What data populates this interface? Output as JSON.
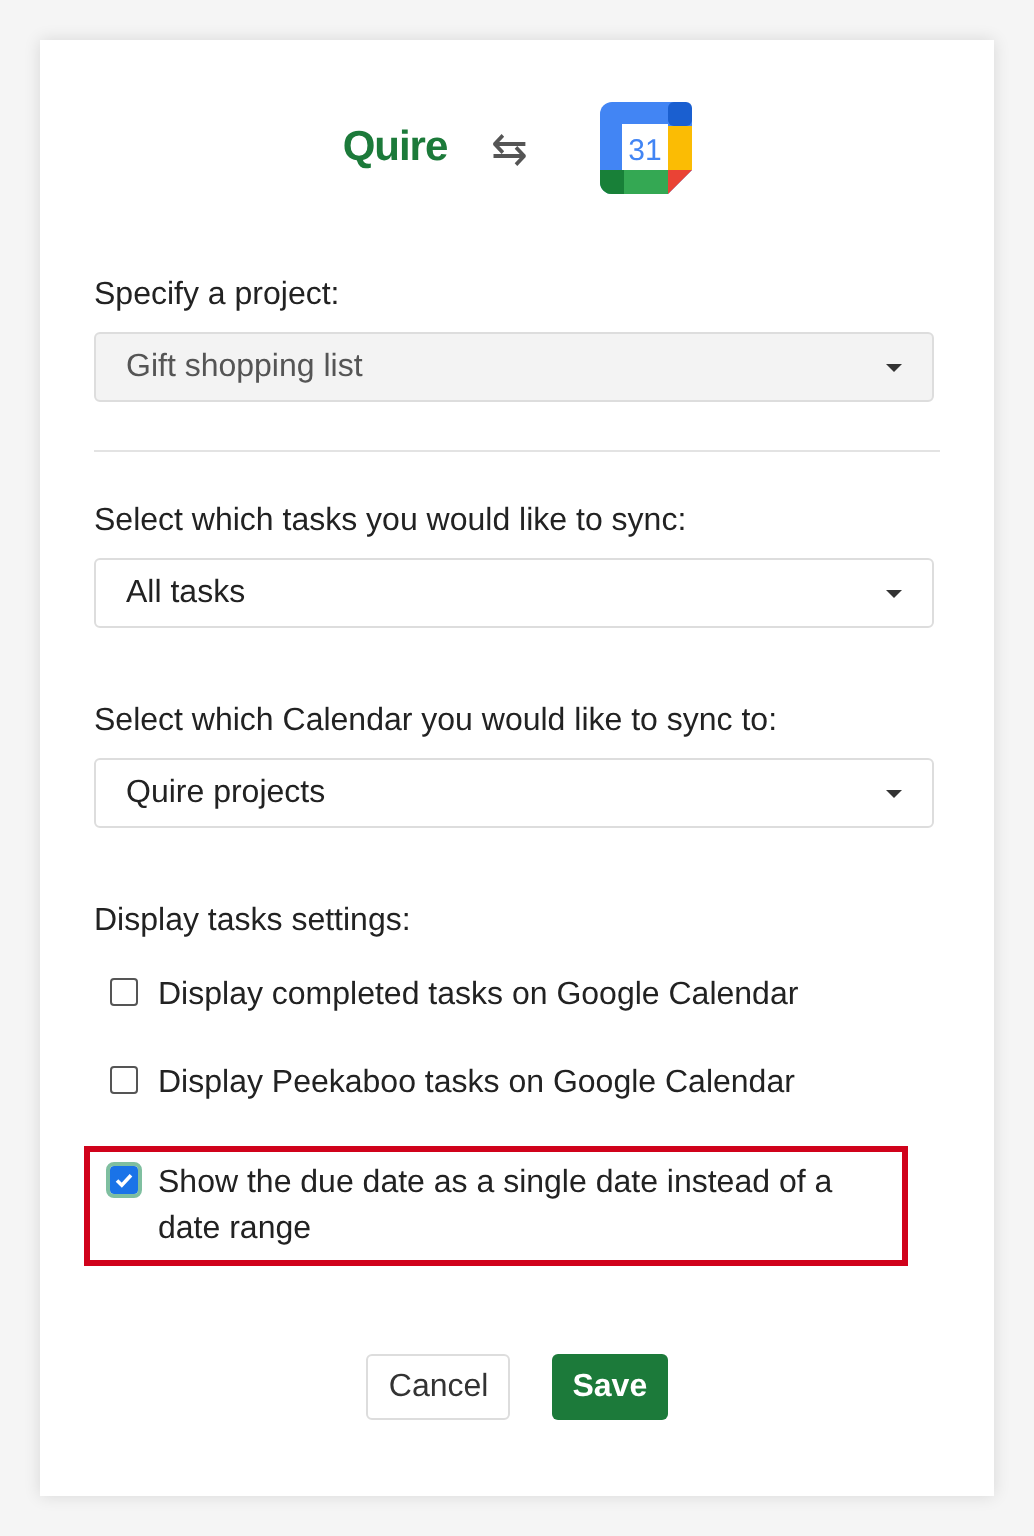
{
  "header": {
    "left_logo": "Quire",
    "swap_icon": "⇆",
    "calendar_day": "31"
  },
  "fields": [
    {
      "label": "Specify a project:",
      "value": "Gift shopping list",
      "disabled": true,
      "divider_after": true
    },
    {
      "label": "Select which tasks you would like to sync:",
      "value": "All tasks",
      "disabled": false,
      "divider_after": false
    },
    {
      "label": "Select which Calendar you would like to sync to:",
      "value": "Quire projects",
      "disabled": false,
      "divider_after": false
    }
  ],
  "settings": {
    "label": "Display tasks settings:",
    "options": [
      {
        "label": "Display completed tasks on Google Calendar",
        "checked": false,
        "highlighted": false
      },
      {
        "label": "Display Peekaboo tasks on Google Calendar",
        "checked": false,
        "highlighted": false
      },
      {
        "label": "Show the due date as a single date instead of a date range",
        "checked": true,
        "highlighted": true
      }
    ]
  },
  "buttons": [
    {
      "label": "Cancel",
      "kind": "secondary"
    },
    {
      "label": "Save",
      "kind": "primary"
    }
  ]
}
